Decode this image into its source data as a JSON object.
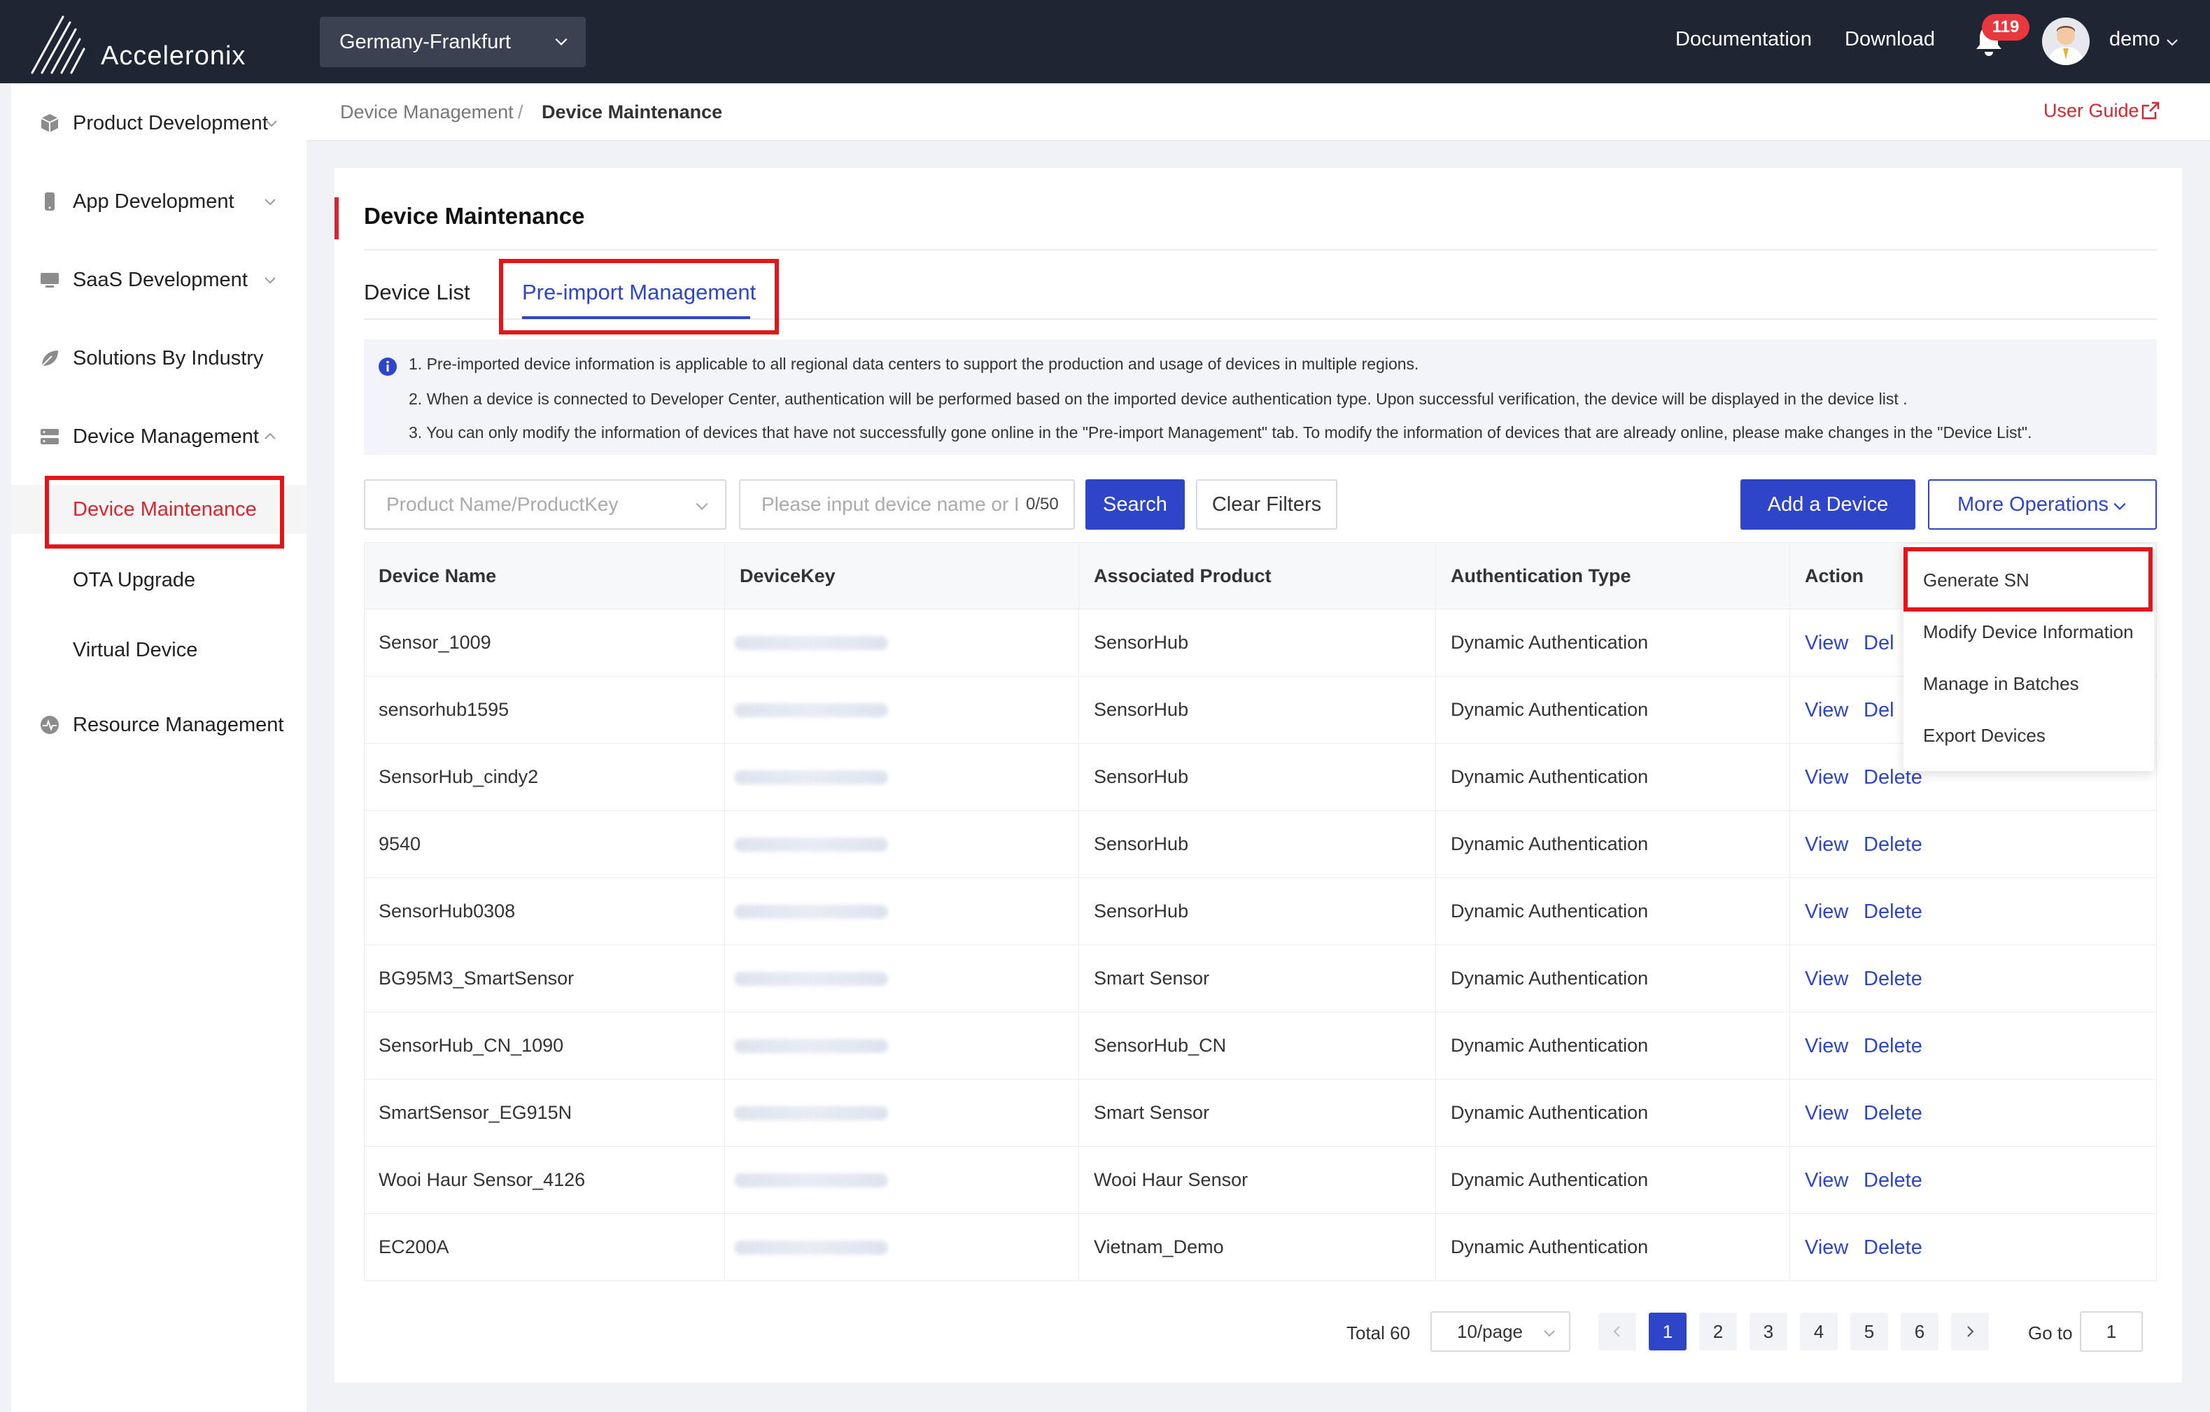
{
  "brand": {
    "name": "Acceleronix"
  },
  "header": {
    "region": "Germany-Frankfurt",
    "links": [
      "Documentation",
      "Download"
    ],
    "notification_count": "119",
    "user": "demo"
  },
  "sidebar": {
    "items": [
      {
        "label": "Product Development",
        "icon": "cube-icon"
      },
      {
        "label": "App Development",
        "icon": "phone-icon"
      },
      {
        "label": "SaaS Development",
        "icon": "monitor-icon"
      },
      {
        "label": "Solutions By Industry",
        "icon": "leaf-icon"
      },
      {
        "label": "Device Management",
        "icon": "server-icon"
      },
      {
        "label": "Resource Management",
        "icon": "pulse-icon"
      }
    ],
    "sub_items": [
      "Device Maintenance",
      "OTA Upgrade",
      "Virtual Device"
    ]
  },
  "breadcrumb": {
    "parent": "Device Management",
    "separator": "/",
    "current": "Device Maintenance"
  },
  "user_guide": "User Guide",
  "page": {
    "title": "Device Maintenance",
    "tabs": [
      "Device List",
      "Pre-import Management"
    ]
  },
  "notice": [
    "1. Pre-imported device information is applicable to all regional data centers to support the production and usage of devices in multiple regions.",
    "2. When a device is connected to Developer Center, authentication will be performed based on the imported device authentication type. Upon successful verification, the device will be displayed in the device list .",
    "3. You can only modify the information of devices that have not successfully gone online in the \"Pre-import Management\" tab. To modify the information of devices that are already online, please make changes in the \"Device List\"."
  ],
  "toolbar": {
    "product_placeholder": "Product Name/ProductKey",
    "search_placeholder": "Please input device name or DeviceKey",
    "search_count": "0/50",
    "search_label": "Search",
    "clear_label": "Clear Filters",
    "add_label": "Add a Device",
    "more_label": "More Operations"
  },
  "table": {
    "headers": [
      "Device Name",
      "DeviceKey",
      "Associated Product",
      "Authentication Type",
      "Action"
    ],
    "rows": [
      {
        "name": "Sensor_1009",
        "product": "SensorHub",
        "auth": "Dynamic Authentication"
      },
      {
        "name": "sensorhub1595",
        "product": "SensorHub",
        "auth": "Dynamic Authentication"
      },
      {
        "name": "SensorHub_cindy2",
        "product": "SensorHub",
        "auth": "Dynamic Authentication"
      },
      {
        "name": "9540",
        "product": "SensorHub",
        "auth": "Dynamic Authentication"
      },
      {
        "name": "SensorHub0308",
        "product": "SensorHub",
        "auth": "Dynamic Authentication"
      },
      {
        "name": "BG95M3_SmartSensor",
        "product": "Smart Sensor",
        "auth": "Dynamic Authentication"
      },
      {
        "name": "SensorHub_CN_1090",
        "product": "SensorHub_CN",
        "auth": "Dynamic Authentication"
      },
      {
        "name": "SmartSensor_EG915N",
        "product": "Smart Sensor",
        "auth": "Dynamic Authentication"
      },
      {
        "name": "Wooi Haur Sensor_4126",
        "product": "Wooi Haur Sensor",
        "auth": "Dynamic Authentication"
      },
      {
        "name": "EC200A",
        "product": "Vietnam_Demo",
        "auth": "Dynamic Authentication"
      }
    ],
    "action_view": "View",
    "action_delete": "Delete",
    "action_delete_truncated": "Del"
  },
  "dropdown": [
    "Generate SN",
    "Modify Device Information",
    "Manage in Batches",
    "Export Devices"
  ],
  "pagination": {
    "total": "Total 60",
    "page_size": "10/page",
    "pages": [
      "1",
      "2",
      "3",
      "4",
      "5",
      "6"
    ],
    "current": "1",
    "goto_label": "Go to",
    "goto_value": "1"
  },
  "colors": {
    "accent": "#2f45c9",
    "brand_red": "#d6262e",
    "header_bg": "#1f2633",
    "highlight": "#e4141b"
  }
}
